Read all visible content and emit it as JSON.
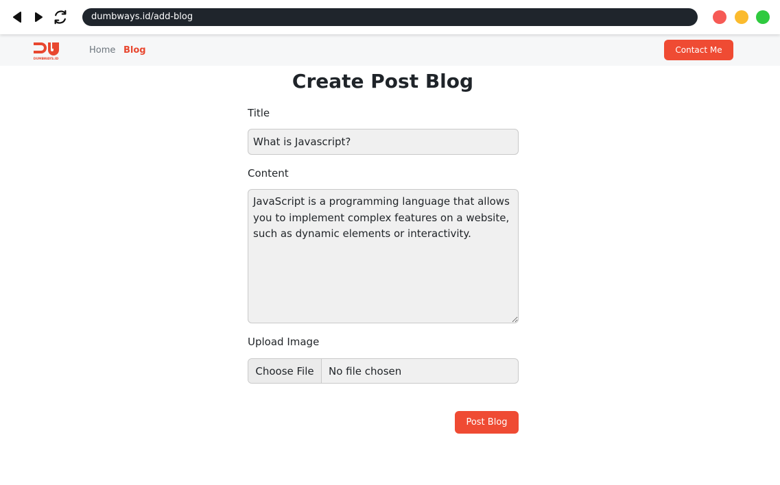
{
  "browser": {
    "url": "dumbways.id/add-blog",
    "icons": [
      "back-icon",
      "forward-icon",
      "reload-icon"
    ],
    "window_dots": [
      {
        "name": "close-dot",
        "color": "#f65a55"
      },
      {
        "name": "minimize-dot",
        "color": "#fbbb2e"
      },
      {
        "name": "maximize-dot",
        "color": "#2fca3f"
      }
    ]
  },
  "navbar": {
    "logo_text": "DUMBWAYS.ID",
    "links": [
      {
        "label": "Home",
        "active": false
      },
      {
        "label": "Blog",
        "active": true
      }
    ],
    "contact_label": "Contact Me"
  },
  "form": {
    "heading": "Create Post Blog",
    "title_label": "Title",
    "title_value": "What is Javascript?",
    "content_label": "Content",
    "content_value": "JavaScript is a programming language that allows you to implement complex features on a website, such as dynamic elements or interactivity.",
    "image_label": "Upload Image",
    "file_button_label": "Choose File",
    "file_status": "No file chosen",
    "submit_label": "Post Blog"
  },
  "colors": {
    "accent": "#ef4b33",
    "url_bar": "#1f252c",
    "navbar_bg": "#f6f7f8"
  }
}
